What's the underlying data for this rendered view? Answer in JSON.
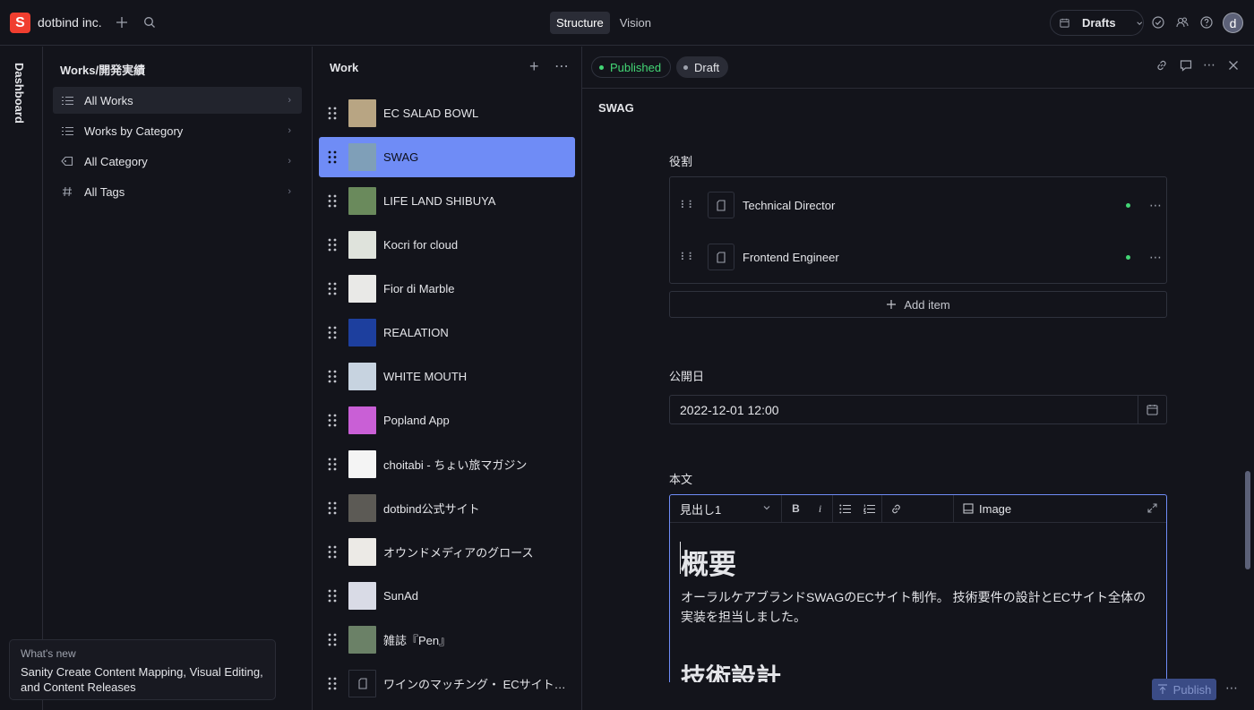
{
  "topbar": {
    "logo_letter": "S",
    "workspace": "dotbind inc.",
    "tabs": [
      "Structure",
      "Vision"
    ],
    "drafts_label": "Drafts",
    "avatar_letter": "d"
  },
  "rail": {
    "label": "Dashboard"
  },
  "nav": {
    "title": "Works/開発実績",
    "items": [
      {
        "label": "All Works",
        "icon": "list-icon"
      },
      {
        "label": "Works by Category",
        "icon": "list-icon"
      },
      {
        "label": "All Category",
        "icon": "tag-icon"
      },
      {
        "label": "All Tags",
        "icon": "hash-icon"
      }
    ]
  },
  "whats_new": {
    "title": "What's new",
    "body": "Sanity Create Content Mapping, Visual Editing, and Content Releases"
  },
  "work_list": {
    "title": "Work",
    "items": [
      {
        "title": "EC SALAD BOWL",
        "thumb": "#b8a583"
      },
      {
        "title": "SWAG",
        "thumb": "#7f9fb8"
      },
      {
        "title": "LIFE LAND SHIBUYA",
        "thumb": "#6a8a5c"
      },
      {
        "title": "Kocri for cloud",
        "thumb": "#dfe3dc"
      },
      {
        "title": "Fior di Marble",
        "thumb": "#e9e9e7"
      },
      {
        "title": "REALATION",
        "thumb": "#1d3f9e"
      },
      {
        "title": "WHITE MOUTH",
        "thumb": "#c7d3e0"
      },
      {
        "title": "Popland App",
        "thumb": "#c95fd6"
      },
      {
        "title": "choitabi - ちょい旅マガジン",
        "thumb": "#f4f4f4"
      },
      {
        "title": "dotbind公式サイト",
        "thumb": "#5c5a55"
      },
      {
        "title": "オウンドメディアのグロース",
        "thumb": "#eceae6"
      },
      {
        "title": "SunAd",
        "thumb": "#d9dbe6"
      },
      {
        "title": "雑誌『Pen』",
        "thumb": "#6b8167"
      },
      {
        "title": "ワインのマッチング・ ECサイト…",
        "thumb": ""
      }
    ]
  },
  "document": {
    "published_label": "Published",
    "draft_label": "Draft",
    "title": "SWAG",
    "roles_label": "役割",
    "roles": [
      "Technical Director",
      "Frontend Engineer"
    ],
    "add_item_label": "Add item",
    "date_label": "公開日",
    "date_value": "2022-12-01 12:00",
    "body_label": "本文",
    "style_select": "見出し1",
    "toolbar": {
      "bold": "B",
      "italic": "i",
      "image_label": "Image"
    },
    "body": {
      "h1": "概要",
      "paragraph": "オーラルケアブランドSWAGのECサイト制作。 技術要件の設計とECサイト全体の実装を担当しました。",
      "h2": "技術設計"
    },
    "publish_label": "Publish"
  },
  "colors": {
    "accent": "#6f8cf6",
    "published": "#43d675",
    "brand": "#f03e2f"
  }
}
